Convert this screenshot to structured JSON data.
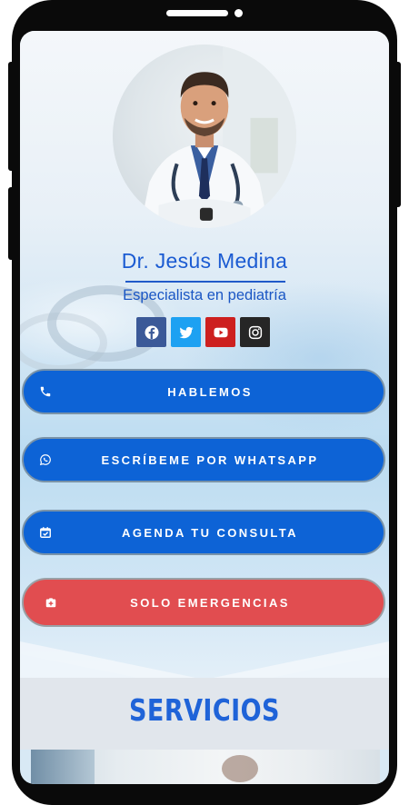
{
  "profile": {
    "name": "Dr. Jesús Medina",
    "subtitle": "Especialista en pediatría",
    "avatar_icon": "doctor-portrait"
  },
  "socials": [
    {
      "icon": "facebook-icon",
      "color": "#3b5998"
    },
    {
      "icon": "twitter-icon",
      "color": "#1da1f2"
    },
    {
      "icon": "youtube-icon",
      "color": "#cd201f"
    },
    {
      "icon": "instagram-icon",
      "color": "#262626"
    }
  ],
  "buttons": {
    "call": {
      "label": "HABLEMOS",
      "icon": "phone-icon",
      "color": "#0d63d6"
    },
    "whatsapp": {
      "label": "ESCRÍBEME POR WHATSAPP",
      "icon": "whatsapp-icon",
      "color": "#0d63d6"
    },
    "appointment": {
      "label": "AGENDA TU CONSULTA",
      "icon": "calendar-check-icon",
      "color": "#0d63d6"
    },
    "emergency": {
      "label": "SOLO EMERGENCIAS",
      "icon": "hospital-icon",
      "color": "#e14d50"
    }
  },
  "services": {
    "title": "SERVICIOS"
  },
  "colors": {
    "accent_blue": "#1b5bd2",
    "phone_frame": "#0a0a0a"
  }
}
